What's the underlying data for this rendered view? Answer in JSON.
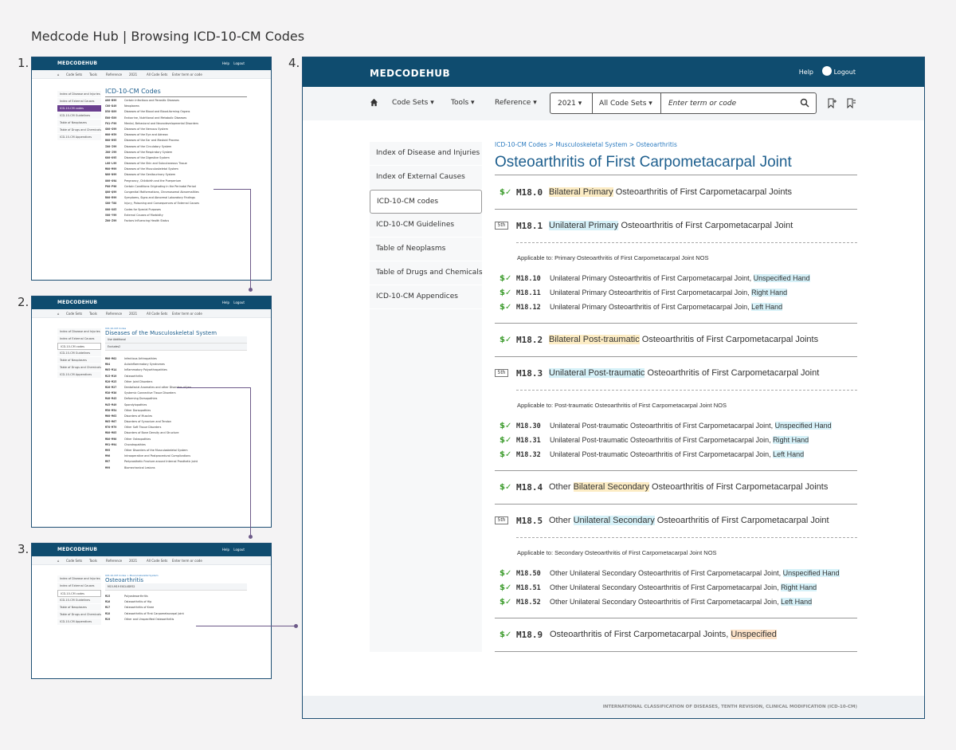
{
  "heading": "Medcode Hub | Browsing ICD-10-CM Codes",
  "step_numbers": [
    "1.",
    "2.",
    "3.",
    "4."
  ],
  "brand": "MEDCODEHUB",
  "header": {
    "help": "Help",
    "logout": "Logout"
  },
  "nav": {
    "code_sets": "Code Sets",
    "tools": "Tools",
    "reference": "Reference",
    "year": "2021",
    "all_code_sets": "All Code Sets",
    "search_placeholder": "Enter term or code"
  },
  "sidebar": [
    "Index of Disease and Injuries",
    "Index of External Causes",
    "ICD-10-CM codes",
    "ICD-10-CM Guidelines",
    "Table of Neoplasms",
    "Table of Drugs and Chemicals",
    "ICD-10-CM Appendices"
  ],
  "screen1": {
    "title": "ICD-10-CM Codes",
    "rows": [
      {
        "code": "A00-B99",
        "text": "Certain Infectious and Parasitic Diseases"
      },
      {
        "code": "C00-D49",
        "text": "Neoplasms"
      },
      {
        "code": "D50-D89",
        "text": "Diseases of the Blood and Blood-forming Organs"
      },
      {
        "code": "E00-E89",
        "text": "Endocrine, Nutritional and Metabolic Diseases"
      },
      {
        "code": "F01-F99",
        "text": "Mental, Behavioral and Neurodevelopmental Disorders"
      },
      {
        "code": "G00-G99",
        "text": "Diseases of the Nervous System"
      },
      {
        "code": "H00-H59",
        "text": "Diseases of the Eye and Adnexa"
      },
      {
        "code": "H60-H95",
        "text": "Diseases of the Ear and Mastoid Process"
      },
      {
        "code": "I00-I99",
        "text": "Diseases of the Circulatory System"
      },
      {
        "code": "J00-J99",
        "text": "Diseases of the Respiratory System"
      },
      {
        "code": "K00-K95",
        "text": "Diseases of the Digestive System"
      },
      {
        "code": "L00-L99",
        "text": "Diseases of the Skin and Subcutaneous Tissue"
      },
      {
        "code": "M00-M99",
        "text": "Diseases of the Musculoskeletal System"
      },
      {
        "code": "N00-N99",
        "text": "Diseases of the Genitourinary System"
      },
      {
        "code": "O00-O9A",
        "text": "Pregnancy, Childbirth and the Puerperium"
      },
      {
        "code": "P00-P96",
        "text": "Certain Conditions Originating in the Perinatal Period"
      },
      {
        "code": "Q00-Q99",
        "text": "Congenital Malformations, Chromosomal Abnormalities"
      },
      {
        "code": "R00-R99",
        "text": "Symptoms, Signs and Abnormal Laboratory Findings"
      },
      {
        "code": "S00-T88",
        "text": "Injury, Poisoning and Consequences of External Causes"
      },
      {
        "code": "U00-U85",
        "text": "Codes for Special Purposes"
      },
      {
        "code": "V00-Y99",
        "text": "External Causes of Morbidity"
      },
      {
        "code": "Z00-Z99",
        "text": "Factors Influencing Health Status"
      }
    ]
  },
  "screen2": {
    "crumb": "ICD-10-CM Codes",
    "title": "Diseases of the Musculoskeletal System",
    "notes": [
      "Use Additional",
      "Excludes2"
    ],
    "rows": [
      {
        "code": "M00-M02",
        "text": "Infectious Arthropathies"
      },
      {
        "code": "M04",
        "text": "Autoinflammatory Syndromes"
      },
      {
        "code": "M05-M14",
        "text": "Inflammatory Polyarthropathies"
      },
      {
        "code": "M15-M19",
        "text": "Osteoarthritis"
      },
      {
        "code": "M20-M25",
        "text": "Other Joint Disorders"
      },
      {
        "code": "M26-M27",
        "text": "Dentofacial Anomalies and other Disorders of Jaw"
      },
      {
        "code": "M30-M36",
        "text": "Systemic Connective Tissue Disorders"
      },
      {
        "code": "M40-M43",
        "text": "Deforming Dorsopathies"
      },
      {
        "code": "M45-M49",
        "text": "Spondylopathies"
      },
      {
        "code": "M50-M54",
        "text": "Other Dorsopathies"
      },
      {
        "code": "M60-M63",
        "text": "Disorders of Muscles"
      },
      {
        "code": "M65-M67",
        "text": "Disorders of Synovium and Tendon"
      },
      {
        "code": "M70-M79",
        "text": "Other Soft Tissue Disorders"
      },
      {
        "code": "M80-M85",
        "text": "Disorders of Bone Density and Structure"
      },
      {
        "code": "M86-M90",
        "text": "Other Osteopathies"
      },
      {
        "code": "M91-M94",
        "text": "Chondropathies"
      },
      {
        "code": "M95",
        "text": "Other Disorders of the Musculoskeletal System"
      },
      {
        "code": "M96",
        "text": "Intraoperative and Postprocedural Complications"
      },
      {
        "code": "M97",
        "text": "Periprosthetic Fracture around Internal Prosthetic Joint"
      },
      {
        "code": "M99",
        "text": "Biomechanical Lesions"
      }
    ]
  },
  "screen3": {
    "crumb": "ICD-10-CM Codes > Musculoskeletal System",
    "title": "Osteoarthritis",
    "note": "M15-M19 EXCLUDES2",
    "rows": [
      {
        "code": "M15",
        "text": "Polyosteoarthritis"
      },
      {
        "code": "M16",
        "text": "Osteoarthritis of Hip"
      },
      {
        "code": "M17",
        "text": "Osteoarthritis of Knee"
      },
      {
        "code": "M18",
        "text": "Osteoarthritis of First Carpometacarpal Joint"
      },
      {
        "code": "M19",
        "text": "Other and Unspecified Osteoarthritis"
      }
    ]
  },
  "screen4": {
    "crumb": "ICD-10-CM Codes > Musculoskeletal System > Osteoarthritis",
    "title": "Osteoarthritis of First Carpometacarpal Joint",
    "fifth_badge": "5th",
    "codes": {
      "m180": {
        "code": "M18.0",
        "hl": "Bilateral Primary",
        "rest": " Osteoarthritis of First Carpometacarpal Joints"
      },
      "m181": {
        "code": "M18.1",
        "hl": "Unilateral Primary",
        "rest": " Osteoarthritis of First Carpometacarpal Joint",
        "applicable": "Applicable to: Primary Osteoarthritis of First Carpometacarpal Joint NOS"
      },
      "m1810": {
        "code": "M18.10",
        "pre": "Unilateral Primary Osteoarthritis of First Carpometacarpal Joint, ",
        "hl": "Unspecified Hand"
      },
      "m1811": {
        "code": "M18.11",
        "pre": "Unilateral Primary Osteoarthritis of First Carpometacarpal Join, ",
        "hl": "Right Hand"
      },
      "m1812": {
        "code": "M18.12",
        "pre": "Unilateral Primary Osteoarthritis of First Carpometacarpal Join, ",
        "hl": "Left Hand"
      },
      "m182": {
        "code": "M18.2",
        "hl": "Bilateral Post-traumatic",
        "rest": " Osteoarthritis of First Carpometacarpal Joints"
      },
      "m183": {
        "code": "M18.3",
        "hl": "Unilateral Post-traumatic",
        "rest": " Osteoarthritis of First Carpometacarpal Joint",
        "applicable": "Applicable to: Post-traumatic Osteoarthritis of First Carpometacarpal Joint NOS"
      },
      "m1830": {
        "code": "M18.30",
        "pre": "Unilateral Post-traumatic Osteoarthritis of First Carpometacarpal Joint, ",
        "hl": "Unspecified Hand"
      },
      "m1831": {
        "code": "M18.31",
        "pre": "Unilateral Post-traumatic Osteoarthritis of First Carpometacarpal Join, ",
        "hl": "Right Hand"
      },
      "m1832": {
        "code": "M18.32",
        "pre": "Unilateral Post-traumatic Osteoarthritis of First Carpometacarpal Join, ",
        "hl": "Left Hand"
      },
      "m184": {
        "code": "M18.4",
        "pre": "Other ",
        "hl": "Bilateral Secondary",
        "rest": " Osteoarthritis of First Carpometacarpal Joints"
      },
      "m185": {
        "code": "M18.5",
        "pre": "Other ",
        "hl": "Unilateral Secondary",
        "rest": " Osteoarthritis of First Carpometacarpal Joint",
        "applicable": "Applicable to: Secondary Osteoarthritis of First Carpometacarpal Joint NOS"
      },
      "m1850": {
        "code": "M18.50",
        "pre": "Other Unilateral Secondary Osteoarthritis of First Carpometacarpal Joint, ",
        "hl": "Unspecified Hand"
      },
      "m1851": {
        "code": "M18.51",
        "pre": "Other Unilateral Secondary Osteoarthritis of First Carpometacarpal Join, ",
        "hl": "Right Hand"
      },
      "m1852": {
        "code": "M18.52",
        "pre": "Other Unilateral Secondary Osteoarthritis of First Carpometacarpal Join, ",
        "hl": "Left Hand"
      },
      "m189": {
        "code": "M18.9",
        "pre": "Osteoarthritis of First Carpometacarpal Joints, ",
        "hl": "Unspecified"
      }
    },
    "footer": "INTERNATIONAL CLASSIFICATION OF DISEASES, TENTH REVISION, CLINICAL MODIFICATION (ICD-10-CM)"
  }
}
